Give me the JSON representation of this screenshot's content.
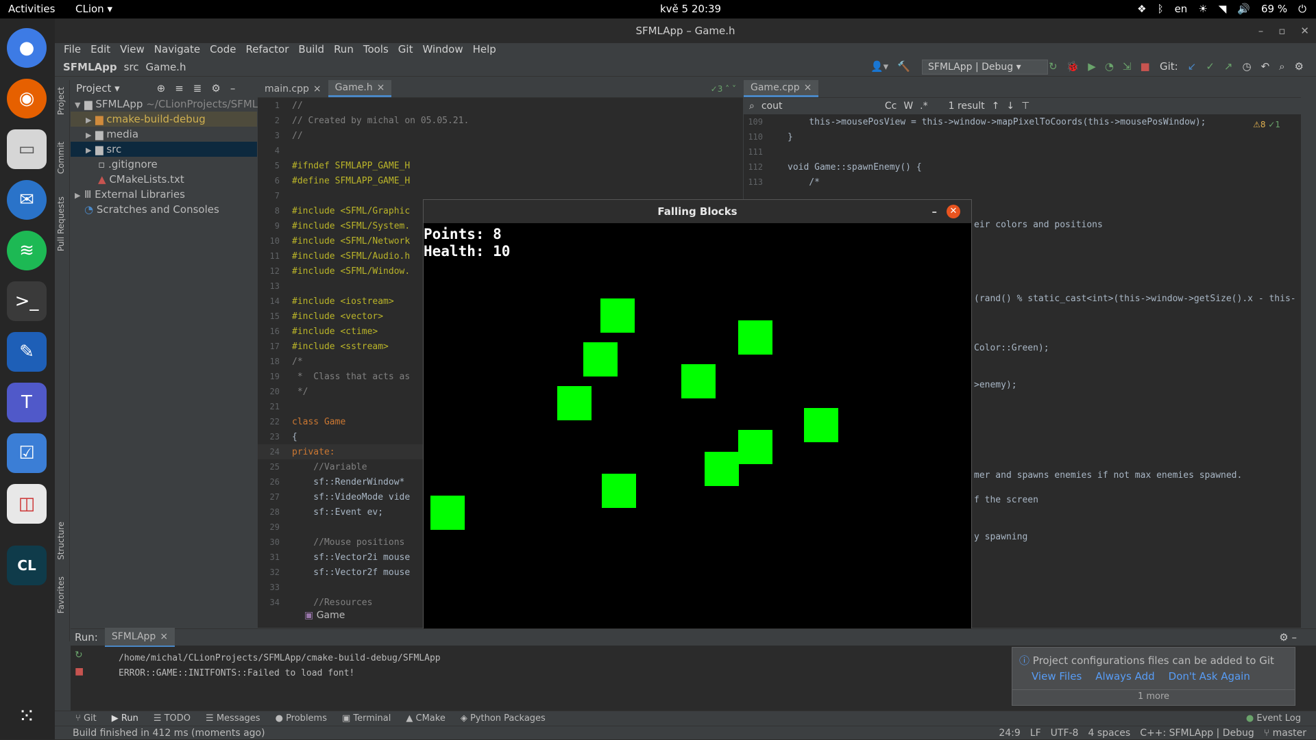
{
  "topbar": {
    "activities": "Activities",
    "app": "CLion",
    "clock": "kvě 5  20:39",
    "lang": "en",
    "battery": "69 %"
  },
  "window": {
    "title": "SFMLApp – Game.h"
  },
  "menu": [
    "File",
    "Edit",
    "View",
    "Navigate",
    "Code",
    "Refactor",
    "Build",
    "Run",
    "Tools",
    "Git",
    "Window",
    "Help"
  ],
  "nav": {
    "crumb1": "SFMLApp",
    "crumb2": "src",
    "crumb3": "Game.h",
    "run_config": "SFMLApp | Debug",
    "git_label": "Git:"
  },
  "project": {
    "header": "Project",
    "root": "SFMLApp",
    "root_path": "~/CLionProjects/SFMLA",
    "items": [
      "cmake-build-debug",
      "media",
      "src",
      ".gitignore",
      "CMakeLists.txt"
    ],
    "external": "External Libraries",
    "scratches": "Scratches and Consoles"
  },
  "leftstrip": {
    "t1": "Project",
    "t2": "Commit",
    "t3": "Pull Requests",
    "t4": "Structure",
    "t5": "Favorites"
  },
  "editor1": {
    "tab1": "main.cpp",
    "tab2": "Game.h",
    "inspect": "3",
    "breadcrumb": "Game",
    "lines": [
      "//",
      "// Created by michal on 05.05.21.",
      "//",
      "",
      "#ifndef SFMLAPP_GAME_H",
      "#define SFMLAPP_GAME_H",
      "",
      "#include <SFML/Graphic",
      "#include <SFML/System.",
      "#include <SFML/Network",
      "#include <SFML/Audio.h",
      "#include <SFML/Window.",
      "",
      "#include <iostream>",
      "#include <vector>",
      "#include <ctime>",
      "#include <sstream>",
      "/*",
      " *  Class that acts as",
      " */",
      "",
      "class Game",
      "{",
      "private:",
      "    //Variable",
      "    sf::RenderWindow*",
      "    sf::VideoMode vide",
      "    sf::Event ev;",
      "",
      "    //Mouse positions",
      "    sf::Vector2i mouse",
      "    sf::Vector2f mouse",
      "",
      "    //Resources"
    ]
  },
  "editor2": {
    "tab": "Game.cpp",
    "search": "cout",
    "results": "1 result",
    "warn": "8",
    "ok": "1",
    "lines": [
      {
        "n": "109",
        "t": "    this->mousePosView = this->window->mapPixelToCoords(this->mousePosWindow);"
      },
      {
        "n": "110",
        "t": "}"
      },
      {
        "n": "111",
        "t": ""
      },
      {
        "n": "112",
        "t": "void Game::spawnEnemy() {"
      },
      {
        "n": "113",
        "t": "    /*"
      }
    ],
    "fragments": [
      "eir colors and positions",
      "(rand() % static_cast<int>(this->window->getSize().x - this-",
      "Color::Green);",
      ">enemy);",
      "mer and spawns enemies if not max enemies spawned.",
      "f the screen",
      "y spawning"
    ]
  },
  "game": {
    "title": "Falling Blocks",
    "points": "Points: 8",
    "health": "Health: 10",
    "block_color": "#00ff00"
  },
  "run": {
    "label": "Run:",
    "config": "SFMLApp",
    "out1": "/home/michal/CLionProjects/SFMLApp/cmake-build-debug/SFMLApp",
    "out2": "ERROR::GAME::INITFONTS::Failed to load font!"
  },
  "notification": {
    "text": "Project configurations files can be added to Git",
    "view": "View Files",
    "always": "Always Add",
    "never": "Don't Ask Again",
    "more": "1 more"
  },
  "toolwindows": [
    "Git",
    "Run",
    "TODO",
    "Messages",
    "Problems",
    "Terminal",
    "CMake",
    "Python Packages"
  ],
  "event_log": "Event Log",
  "status": {
    "build": "Build finished in 412 ms (moments ago)",
    "pos": "24:9",
    "lf": "LF",
    "enc": "UTF-8",
    "indent": "4 spaces",
    "ctx": "C++: SFMLApp | Debug",
    "branch": "master"
  }
}
